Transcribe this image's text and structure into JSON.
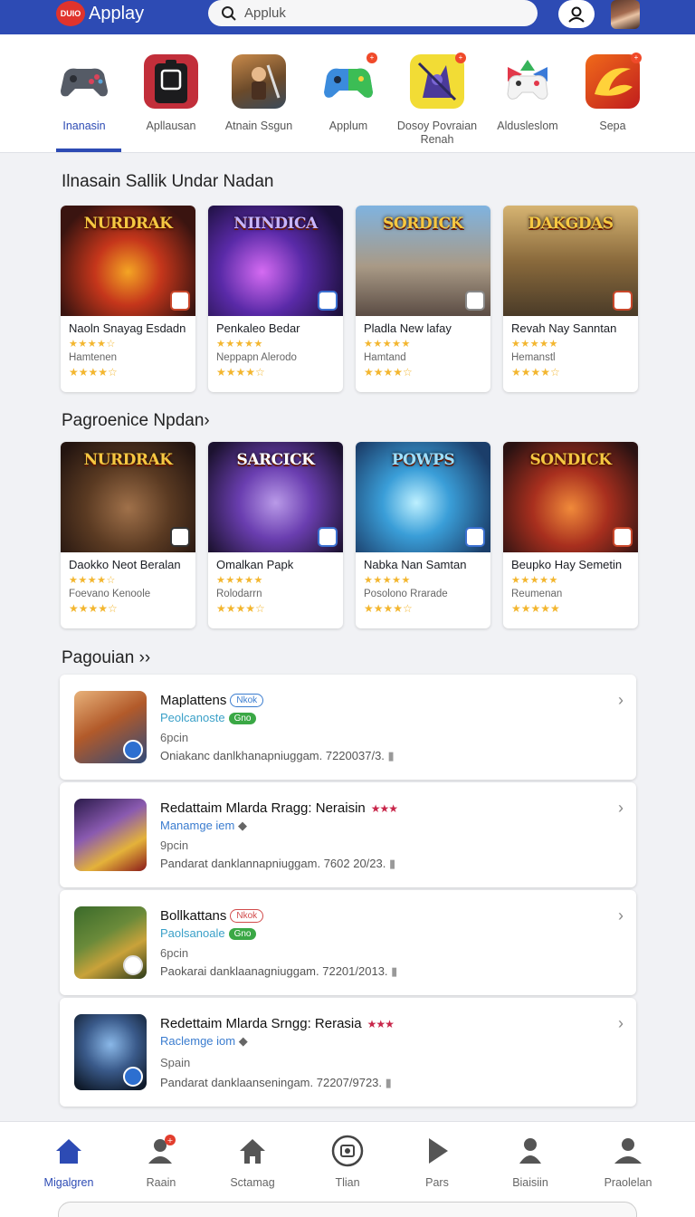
{
  "header": {
    "logo_badge": "DUIO",
    "app_name": "Applay",
    "search_placeholder": "Appluk"
  },
  "categories": [
    {
      "label": "Inanasin",
      "active": true,
      "icon": "gamepad-icon"
    },
    {
      "label": "Apllausan",
      "icon": "device-icon"
    },
    {
      "label": "Atnain Ssgun",
      "icon": "warrior-icon"
    },
    {
      "label": "Applum",
      "icon": "controller-icon",
      "badge": "+"
    },
    {
      "label": "Dosoy Povraian Renah",
      "icon": "creature-icon",
      "badge": "+"
    },
    {
      "label": "Aldusleslom",
      "icon": "puzzle-controller-icon"
    },
    {
      "label": "Sepa",
      "icon": "swirl-icon",
      "badge": "+"
    }
  ],
  "section1": {
    "title": "Ilnasain Sallik Undar Nadan",
    "cards": [
      {
        "art_title": "NURDRAK",
        "name": "Naoln Snayag Esdadn",
        "stars": "★★★★☆",
        "sub": "Hamtenen",
        "stars2": "★★★★☆"
      },
      {
        "art_title": "NIINDICA",
        "name": "Penkaleo Bedar",
        "stars": "★★★★★",
        "sub": "Neppapn Alerodo",
        "stars2": "★★★★☆"
      },
      {
        "art_title": "SORDICK",
        "name": "Pladla New lafay",
        "stars": "★★★★★",
        "sub": "Hamtand",
        "stars2": "★★★★☆"
      },
      {
        "art_title": "DAKGDAS",
        "name": "Revah Nay Sanntan",
        "stars": "★★★★★",
        "sub": "Hemanstl",
        "stars2": "★★★★☆"
      }
    ]
  },
  "section2": {
    "title": "Pagroenice Npdan›",
    "cards": [
      {
        "art_title": "NURDRAK",
        "name": "Daokko Neot Beralan",
        "stars": "★★★★☆",
        "sub": "Foevano Kenoole",
        "stars2": "★★★★☆"
      },
      {
        "art_title": "SARCICK",
        "name": "Omalkan Papk",
        "stars": "★★★★★",
        "sub": "Rolodarrn",
        "stars2": "★★★★☆"
      },
      {
        "art_title": "POWPS",
        "name": "Nabka Nan Samtan",
        "stars": "★★★★★",
        "sub": "Posolono Rrarade",
        "stars2": "★★★★☆"
      },
      {
        "art_title": "SONDICK",
        "name": "Beupko Hay Semetin",
        "stars": "★★★★★",
        "sub": "Reumenan",
        "stars2": "★★★★★"
      }
    ]
  },
  "section3": {
    "title": "Pagouian ››",
    "rows": [
      {
        "title": "Maplattens",
        "pill": "Nkok",
        "line2": "Peolcanoste",
        "tag": "Gno",
        "line3": "6pcin",
        "line4": "Oniakanc danlkhanapniuggam.  7220037/3."
      },
      {
        "title": "Redattaim Mlarda Rragg: Neraisin",
        "stars": "★★★",
        "line2": "Manamge iem",
        "line3": "9pcin",
        "line4": "Pandarat danklannapniuggam.  7602 20/23."
      },
      {
        "title": "Bollkattans",
        "pill": "Nkok",
        "line2": "Paolsanoale",
        "tag": "Gno",
        "line3": "6pcin",
        "line4": "Paokarai danklaanagniuggam.  72201/2013."
      },
      {
        "title": "Redettaim Mlarda Srngg: Rerasia",
        "stars": "★★★",
        "line2": "Raclemge iom",
        "line3": "Spain",
        "line4": "Pandarat danklaanseningam.  72207/9723."
      }
    ]
  },
  "bottom_nav": [
    {
      "label": "Migalgren",
      "icon": "home-icon",
      "active": true
    },
    {
      "label": "Raain",
      "icon": "user-alert-icon"
    },
    {
      "label": "Sctamag",
      "icon": "house-icon"
    },
    {
      "label": "Tlian",
      "icon": "camera-icon"
    },
    {
      "label": "Pars",
      "icon": "play-icon"
    },
    {
      "label": "Biaisiin",
      "icon": "person-icon"
    },
    {
      "label": "Praolelan",
      "icon": "profile-icon"
    }
  ],
  "colors": {
    "brand": "#2d4bb4",
    "star": "#f3b62f"
  }
}
